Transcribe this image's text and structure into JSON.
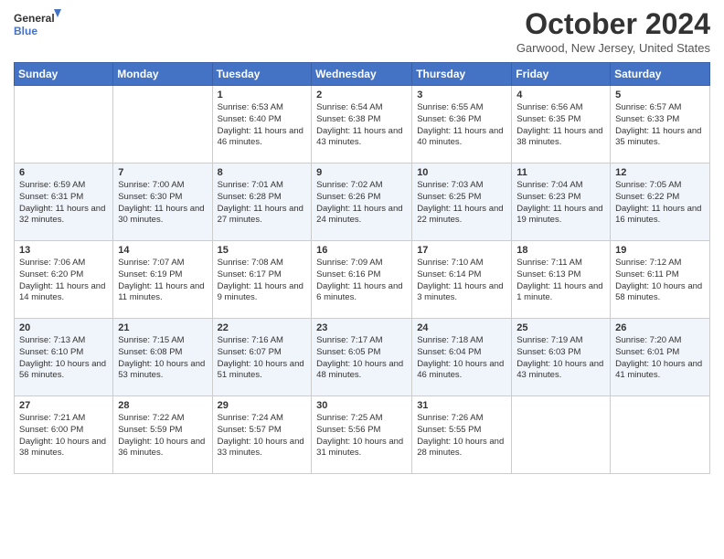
{
  "logo": {
    "line1": "General",
    "line2": "Blue"
  },
  "title": "October 2024",
  "location": "Garwood, New Jersey, United States",
  "days_of_week": [
    "Sunday",
    "Monday",
    "Tuesday",
    "Wednesday",
    "Thursday",
    "Friday",
    "Saturday"
  ],
  "weeks": [
    [
      {
        "day": "",
        "info": ""
      },
      {
        "day": "",
        "info": ""
      },
      {
        "day": "1",
        "info": "Sunrise: 6:53 AM\nSunset: 6:40 PM\nDaylight: 11 hours and 46 minutes."
      },
      {
        "day": "2",
        "info": "Sunrise: 6:54 AM\nSunset: 6:38 PM\nDaylight: 11 hours and 43 minutes."
      },
      {
        "day": "3",
        "info": "Sunrise: 6:55 AM\nSunset: 6:36 PM\nDaylight: 11 hours and 40 minutes."
      },
      {
        "day": "4",
        "info": "Sunrise: 6:56 AM\nSunset: 6:35 PM\nDaylight: 11 hours and 38 minutes."
      },
      {
        "day": "5",
        "info": "Sunrise: 6:57 AM\nSunset: 6:33 PM\nDaylight: 11 hours and 35 minutes."
      }
    ],
    [
      {
        "day": "6",
        "info": "Sunrise: 6:59 AM\nSunset: 6:31 PM\nDaylight: 11 hours and 32 minutes."
      },
      {
        "day": "7",
        "info": "Sunrise: 7:00 AM\nSunset: 6:30 PM\nDaylight: 11 hours and 30 minutes."
      },
      {
        "day": "8",
        "info": "Sunrise: 7:01 AM\nSunset: 6:28 PM\nDaylight: 11 hours and 27 minutes."
      },
      {
        "day": "9",
        "info": "Sunrise: 7:02 AM\nSunset: 6:26 PM\nDaylight: 11 hours and 24 minutes."
      },
      {
        "day": "10",
        "info": "Sunrise: 7:03 AM\nSunset: 6:25 PM\nDaylight: 11 hours and 22 minutes."
      },
      {
        "day": "11",
        "info": "Sunrise: 7:04 AM\nSunset: 6:23 PM\nDaylight: 11 hours and 19 minutes."
      },
      {
        "day": "12",
        "info": "Sunrise: 7:05 AM\nSunset: 6:22 PM\nDaylight: 11 hours and 16 minutes."
      }
    ],
    [
      {
        "day": "13",
        "info": "Sunrise: 7:06 AM\nSunset: 6:20 PM\nDaylight: 11 hours and 14 minutes."
      },
      {
        "day": "14",
        "info": "Sunrise: 7:07 AM\nSunset: 6:19 PM\nDaylight: 11 hours and 11 minutes."
      },
      {
        "day": "15",
        "info": "Sunrise: 7:08 AM\nSunset: 6:17 PM\nDaylight: 11 hours and 9 minutes."
      },
      {
        "day": "16",
        "info": "Sunrise: 7:09 AM\nSunset: 6:16 PM\nDaylight: 11 hours and 6 minutes."
      },
      {
        "day": "17",
        "info": "Sunrise: 7:10 AM\nSunset: 6:14 PM\nDaylight: 11 hours and 3 minutes."
      },
      {
        "day": "18",
        "info": "Sunrise: 7:11 AM\nSunset: 6:13 PM\nDaylight: 11 hours and 1 minute."
      },
      {
        "day": "19",
        "info": "Sunrise: 7:12 AM\nSunset: 6:11 PM\nDaylight: 10 hours and 58 minutes."
      }
    ],
    [
      {
        "day": "20",
        "info": "Sunrise: 7:13 AM\nSunset: 6:10 PM\nDaylight: 10 hours and 56 minutes."
      },
      {
        "day": "21",
        "info": "Sunrise: 7:15 AM\nSunset: 6:08 PM\nDaylight: 10 hours and 53 minutes."
      },
      {
        "day": "22",
        "info": "Sunrise: 7:16 AM\nSunset: 6:07 PM\nDaylight: 10 hours and 51 minutes."
      },
      {
        "day": "23",
        "info": "Sunrise: 7:17 AM\nSunset: 6:05 PM\nDaylight: 10 hours and 48 minutes."
      },
      {
        "day": "24",
        "info": "Sunrise: 7:18 AM\nSunset: 6:04 PM\nDaylight: 10 hours and 46 minutes."
      },
      {
        "day": "25",
        "info": "Sunrise: 7:19 AM\nSunset: 6:03 PM\nDaylight: 10 hours and 43 minutes."
      },
      {
        "day": "26",
        "info": "Sunrise: 7:20 AM\nSunset: 6:01 PM\nDaylight: 10 hours and 41 minutes."
      }
    ],
    [
      {
        "day": "27",
        "info": "Sunrise: 7:21 AM\nSunset: 6:00 PM\nDaylight: 10 hours and 38 minutes."
      },
      {
        "day": "28",
        "info": "Sunrise: 7:22 AM\nSunset: 5:59 PM\nDaylight: 10 hours and 36 minutes."
      },
      {
        "day": "29",
        "info": "Sunrise: 7:24 AM\nSunset: 5:57 PM\nDaylight: 10 hours and 33 minutes."
      },
      {
        "day": "30",
        "info": "Sunrise: 7:25 AM\nSunset: 5:56 PM\nDaylight: 10 hours and 31 minutes."
      },
      {
        "day": "31",
        "info": "Sunrise: 7:26 AM\nSunset: 5:55 PM\nDaylight: 10 hours and 28 minutes."
      },
      {
        "day": "",
        "info": ""
      },
      {
        "day": "",
        "info": ""
      }
    ]
  ]
}
